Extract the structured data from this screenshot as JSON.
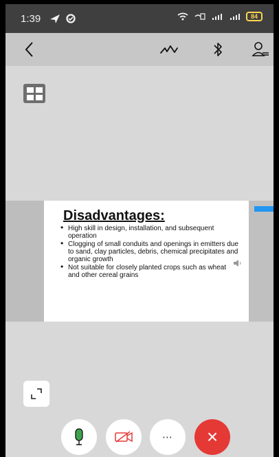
{
  "status": {
    "time": "1:39",
    "battery": "84"
  },
  "slide": {
    "title": "Disadvantages:",
    "bullets": [
      "High skill in design, installation, and subsequent operation",
      "Clogging of small conduits and openings in emitters due to sand, clay particles, debris, chemical precipitates and organic growth",
      "Not suitable for closely planted crops such as wheat and other cereal grains"
    ]
  },
  "colors": {
    "end_call": "#e53935",
    "mic": "#3fa34d",
    "camera": "#e53935"
  }
}
